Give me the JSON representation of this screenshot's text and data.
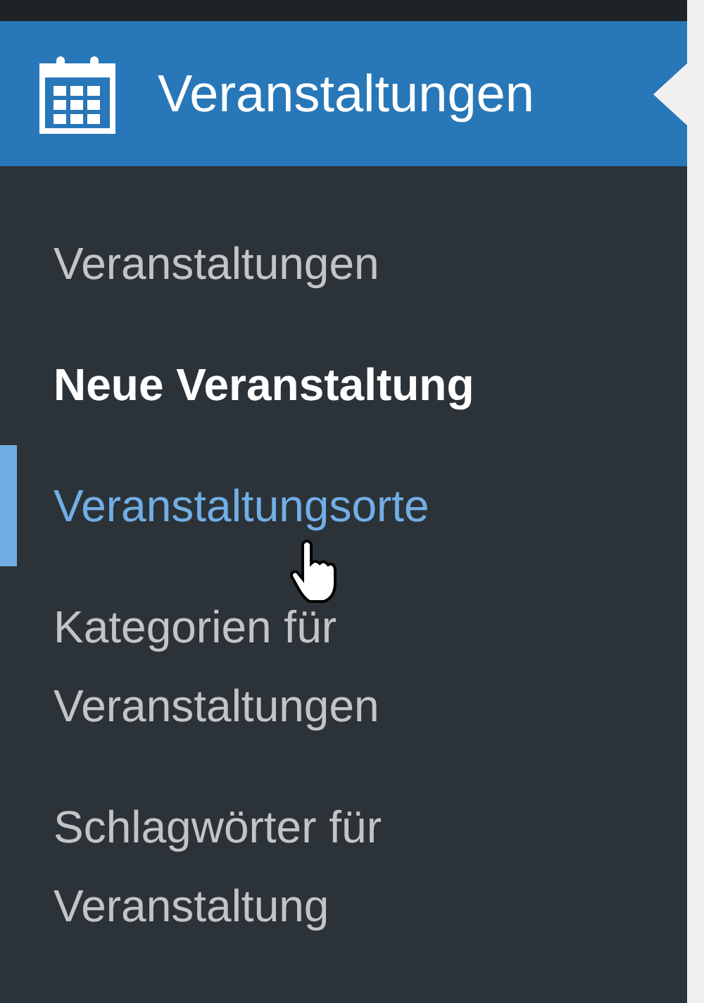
{
  "menu": {
    "title": "Veranstaltungen",
    "expanded": true,
    "items": [
      {
        "label": "Veranstaltungen",
        "selected": false,
        "hovered": false
      },
      {
        "label": "Neue Veranstaltung",
        "selected": true,
        "hovered": false
      },
      {
        "label": "Veranstaltungsorte",
        "selected": false,
        "hovered": true
      },
      {
        "label": "Kategorien für Veranstaltungen",
        "selected": false,
        "hovered": false
      },
      {
        "label": "Schlagwörter für Veranstaltung",
        "selected": false,
        "hovered": false
      }
    ]
  }
}
